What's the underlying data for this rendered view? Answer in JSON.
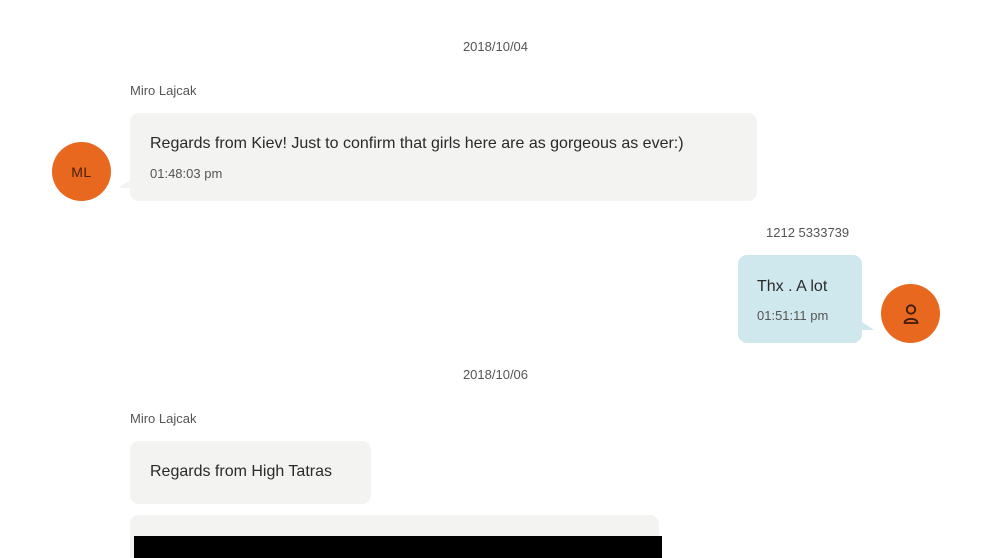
{
  "conversation": {
    "groups": [
      {
        "date": "2018/10/04",
        "messages": [
          {
            "direction": "incoming",
            "sender": "Miro Lajcak",
            "avatar_initials": "ML",
            "text": "Regards from Kiev! Just to confirm that girls here are as gorgeous as ever:)",
            "time": "01:48:03 pm"
          },
          {
            "direction": "outgoing",
            "sender": "1212 5333739",
            "avatar_icon": "user-icon",
            "text": "Thx . A lot",
            "time": "01:51:11 pm"
          }
        ]
      },
      {
        "date": "2018/10/06",
        "messages": [
          {
            "direction": "incoming",
            "sender": "Miro Lajcak",
            "text": "Regards from High Tatras"
          },
          {
            "direction": "incoming",
            "attachment": "image"
          }
        ]
      }
    ]
  },
  "colors": {
    "avatar": "#e8681f",
    "incoming_bubble": "#f3f3f1",
    "outgoing_bubble": "#cfe8ee",
    "attachment": "#000000"
  }
}
